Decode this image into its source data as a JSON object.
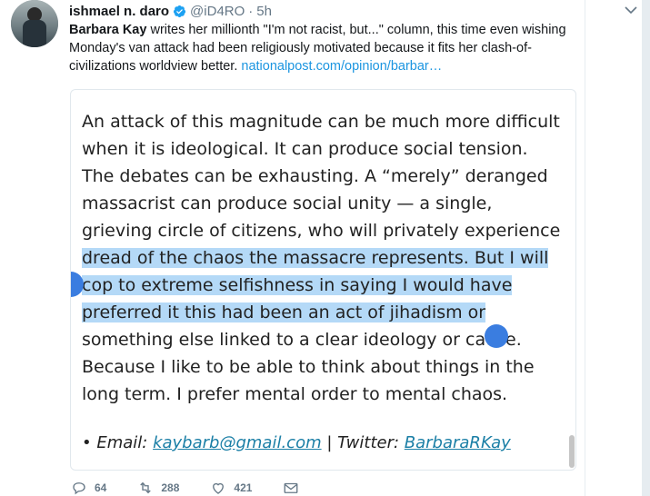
{
  "tweet": {
    "display_name": "ishmael n. daro",
    "handle": "@iD4RO",
    "separator": "·",
    "time": "5h",
    "text_mention": "Barbara Kay",
    "text_body": " writes her millionth \"I'm not racist, but...\" column, this time even wishing Monday's van attack had been religiously motivated because it fits her clash-of-civilizations worldview better. ",
    "text_link": "nationalpost.com/opinion/barbar…"
  },
  "card": {
    "lines": [
      "An attack of this magnitude can be much more difficult",
      "when it is ideological. It can produce social tension.",
      "The debates can be exhausting. A “merely” deranged",
      "massacrist can produce social unity — a single,",
      "grieving circle of citizens, who will privately experience",
      "dread of the chaos the massacre represents. But I will",
      "cop to extreme selfishness in saying I would have",
      "preferred it this had been an act of jihadism or",
      "something else linked to a clear ideology or cause.",
      "Because I like to be able to think about things in the",
      "long term. I prefer mental order to mental chaos."
    ],
    "footer_prefix": "• Email: ",
    "email": "kaybarb@gmail.com",
    "footer_sep": " | Twitter: ",
    "twitter": "BarbaraRKay"
  },
  "actions": {
    "replies": "64",
    "retweets": "288",
    "likes": "421"
  },
  "colors": {
    "link": "#1b95e0",
    "selection": "#b4d9f7",
    "selection_handle": "#3a7de0"
  }
}
